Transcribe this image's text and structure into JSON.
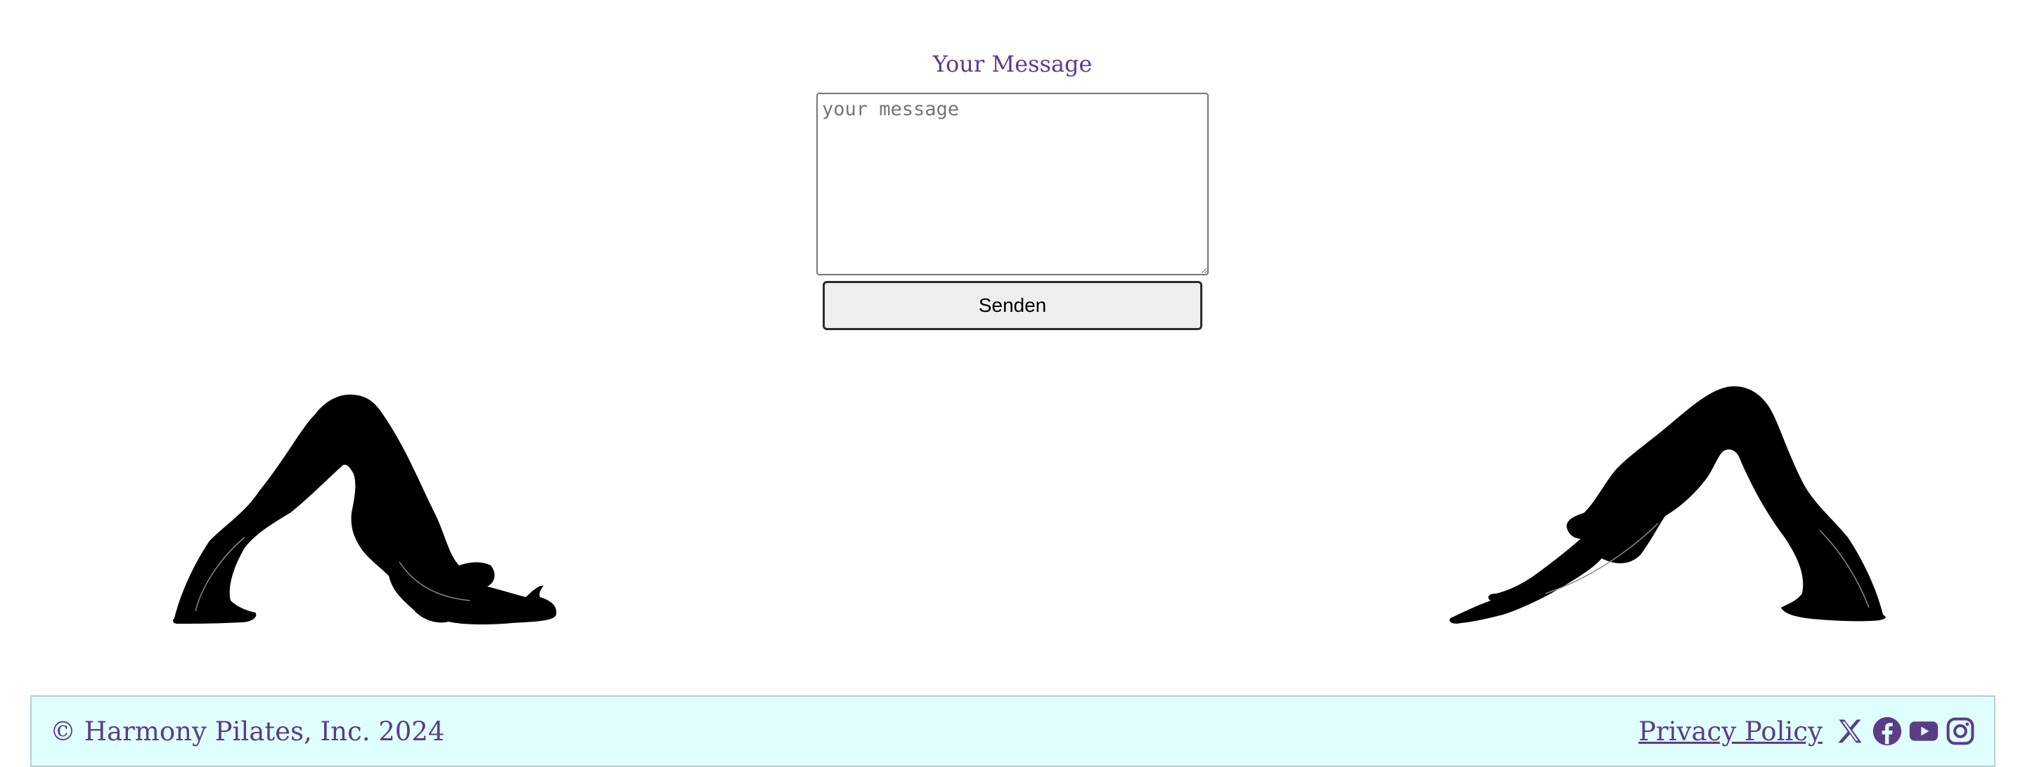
{
  "form": {
    "message_label": "Your Message",
    "message_placeholder": "your message",
    "message_value": "",
    "send_label": "Senden"
  },
  "illustrations": {
    "left": "yoga-pose-icon",
    "right": "yoga-pose-icon"
  },
  "footer": {
    "copyright": "© Harmony Pilates, Inc. 2024",
    "privacy_label": "Privacy Policy",
    "social": [
      "x-icon",
      "facebook-icon",
      "youtube-icon",
      "instagram-icon"
    ]
  },
  "colors": {
    "accent": "#5a3d86",
    "footer_bg": "#e0ffff",
    "button_bg": "#efefef"
  }
}
